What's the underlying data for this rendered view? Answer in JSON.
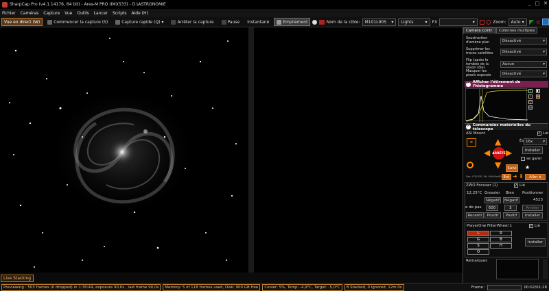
{
  "window": {
    "title": "SharpCap Pro (v4.1.14176, 64 bit) - Ares-M PRO (IMX533) - D:\\ASTRONOMIE",
    "controls": [
      "_",
      "□",
      "✕"
    ]
  },
  "menu": [
    "Fichier",
    "Caméras",
    "Capture",
    "Vue",
    "Outils",
    "Lancer",
    "Scripts",
    "Aide (H)"
  ],
  "toolbar": {
    "live_view": "Vue en direct (W)",
    "start_capture": "Commencer la capture (S)",
    "quick_capture": "Capture rapide (Q)",
    "stop_capture": "Arrêter la capture",
    "pause": "Pause",
    "snapshot": "Instantané",
    "stacking": "Empilement",
    "target_label": "Nom de la cible:",
    "target_value": "M101L905",
    "frame_type": "Lights",
    "fx_label": "FX",
    "zoom_label": "Zoom:",
    "zoom_value": "Auto"
  },
  "right_panel": {
    "tab_camera": "Camera Contr",
    "tab_multi": "Colonnes multiples",
    "rows": [
      {
        "label": "Soustraction d'amène plan",
        "value": "Désactivé"
      },
      {
        "label": "Supprimer les traces satellites",
        "value": "Désactivé"
      },
      {
        "label": "Flip (après le tombée de la vision rôle)",
        "value": "Aucun"
      },
      {
        "label": "Masquer les pixels exposés",
        "value": "Désactivé"
      }
    ],
    "histogram_title": "Afficher l'étirement de l'histogramme",
    "mount_section": "Commandes matérielles du télescope",
    "mount": {
      "name": "ASI Mount",
      "connected_label": "Lié",
      "evaluate_label": "Évaluer:",
      "speed": "16x",
      "install_label": "Installer",
      "park_label": "se garer",
      "stop_label": "ARRÊTÉ",
      "follow_label": "Suivi",
      "en_label": "Ent",
      "go_label": "Aller à",
      "info": "Dec: 0°00'00\" RA: 00h00m00s"
    },
    "focuser": {
      "name": "ZWO Focuser (1)",
      "connected_label": "Lié",
      "temp": "12,25°C",
      "coarse": "Grossier",
      "fine": "Bien",
      "position_label": "Positionner",
      "position_value": "4523",
      "step_label": "e de pas",
      "step_value": "600",
      "fine_value": "5",
      "neg1": "Négatif",
      "neg2": "Négatif",
      "stop": "Arrêter",
      "recenter": "Recentr",
      "pos1": "Positif",
      "pos2": "Positif",
      "install": "Installer"
    },
    "filterwheel": {
      "name": "PlayerOne FilterWheel 1",
      "connected_label": "Lié",
      "filters": [
        "L",
        "R",
        "G",
        "B",
        "S",
        "H",
        "O"
      ],
      "selected": "L",
      "install": "Installer"
    },
    "remarks_label": "Remarques"
  },
  "bottom": {
    "live_stacking": "Live Stacking",
    "status": [
      "Previewing : 503 frames (0 dropped) in 1:30:44, exposure 90,0s , last frame 90,0s",
      "Memory: 5 of 118 frames used, Disk: 900 GB free",
      "Cooler: 5%, Temp: -4,9°C, Target: -5,0°C",
      "8 Stacked, 0 Ignored, 12m 0s"
    ],
    "frame_label": "Frame :",
    "time": "00:02/01:28"
  }
}
